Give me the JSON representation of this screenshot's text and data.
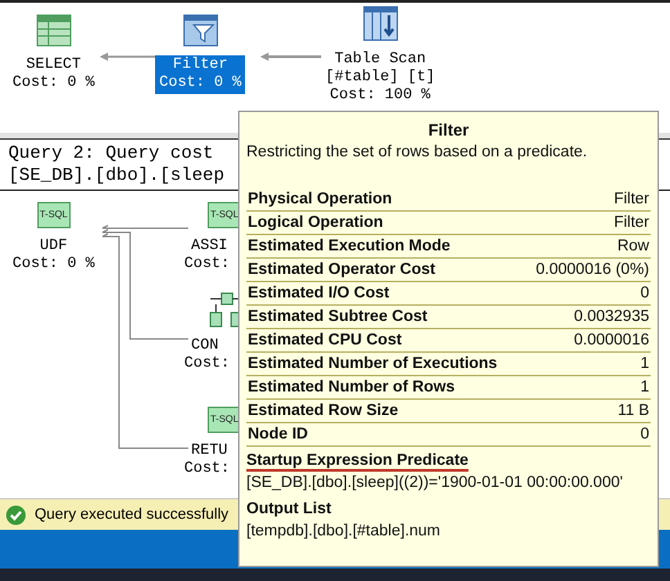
{
  "plan1": {
    "nodes": [
      {
        "kind": "select",
        "lines": [
          "SELECT"
        ],
        "cost": "Cost: 0 %",
        "selected": false
      },
      {
        "kind": "filter",
        "lines": [
          "Filter"
        ],
        "cost": "Cost: 0 %",
        "selected": true
      },
      {
        "kind": "scan",
        "lines": [
          "Table Scan",
          "[#table] [t]"
        ],
        "cost": "Cost: 100 %",
        "selected": false
      }
    ]
  },
  "query2": {
    "header": [
      "Query 2: Query cost",
      "[SE_DB].[dbo].[sleep"
    ],
    "nodes": [
      {
        "kind": "tsql",
        "badge": "T-SQL",
        "lines": [
          "UDF"
        ],
        "cost": "Cost: 0 %"
      },
      {
        "kind": "tsql",
        "badge": "T-SQL",
        "lines": [
          "ASSI"
        ],
        "cost": "Cost:"
      },
      {
        "kind": "cond",
        "lines": [
          "CON"
        ],
        "cost": "Cost:"
      },
      {
        "kind": "tsql",
        "badge": "T-SQL",
        "lines": [
          "RETU"
        ],
        "cost": "Cost:"
      }
    ]
  },
  "status": {
    "text": "Query executed successfully"
  },
  "tooltip": {
    "title": "Filter",
    "description": "Restricting the set of rows based on a predicate.",
    "rows": [
      {
        "name": "Physical Operation",
        "value": "Filter"
      },
      {
        "name": "Logical Operation",
        "value": "Filter"
      },
      {
        "name": "Estimated Execution Mode",
        "value": "Row"
      },
      {
        "name": "Estimated Operator Cost",
        "value": "0.0000016 (0%)"
      },
      {
        "name": "Estimated I/O Cost",
        "value": "0"
      },
      {
        "name": "Estimated Subtree Cost",
        "value": "0.0032935"
      },
      {
        "name": "Estimated CPU Cost",
        "value": "0.0000016"
      },
      {
        "name": "Estimated Number of Executions",
        "value": "1"
      },
      {
        "name": "Estimated Number of Rows",
        "value": "1"
      },
      {
        "name": "Estimated Row Size",
        "value": "11 B"
      },
      {
        "name": "Node ID",
        "value": "0"
      }
    ],
    "sections": [
      {
        "heading": "Startup Expression Predicate",
        "text": "[SE_DB].[dbo].[sleep]((2))='1900-01-01 00:00:00.000'",
        "underlined": true
      },
      {
        "heading": "Output List",
        "text": "[tempdb].[dbo].[#table].num",
        "underlined": false
      }
    ]
  }
}
